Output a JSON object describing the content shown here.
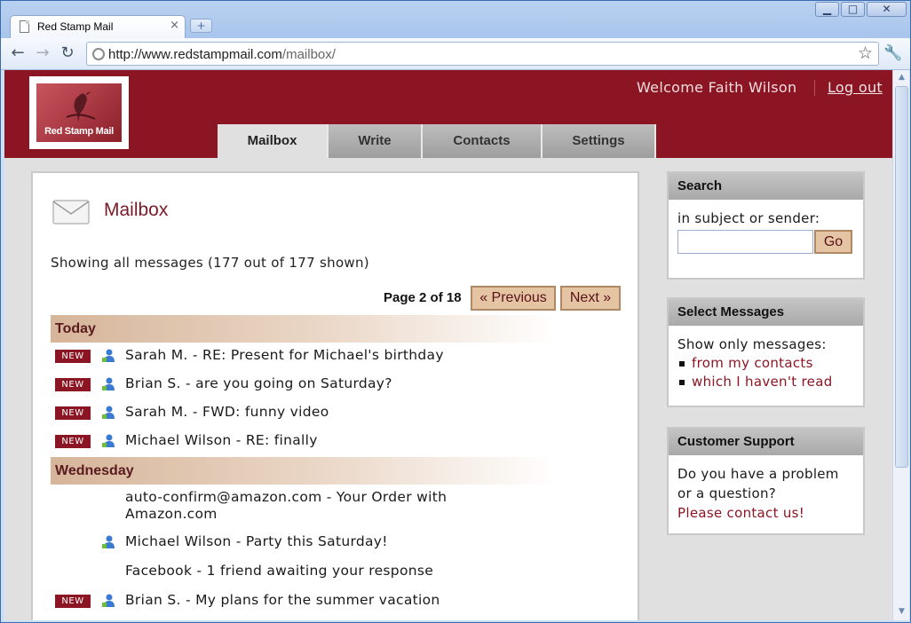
{
  "browser": {
    "tab_title": "Red Stamp Mail",
    "tab_close": "×",
    "new_tab": "+",
    "url_main": "http://www.redstampmail.com",
    "url_path": "/mailbox/",
    "window_controls": [
      "minimize",
      "maximize",
      "close"
    ]
  },
  "header": {
    "logo_text": "Red Stamp Mail",
    "welcome": "Welcome Faith Wilson",
    "logout": "Log out",
    "accent": "#8b1522"
  },
  "nav": {
    "tabs": [
      {
        "label": "Mailbox",
        "active": true
      },
      {
        "label": "Write",
        "active": false
      },
      {
        "label": "Contacts",
        "active": false
      },
      {
        "label": "Settings",
        "active": false
      }
    ]
  },
  "mailbox": {
    "title": "Mailbox",
    "showing": "Showing all messages (177 out of 177 shown)",
    "page_info": "Page 2 of 18",
    "prev_label": "« Previous",
    "next_label": "Next »",
    "new_badge": "NEW",
    "groups": [
      {
        "day": "Today",
        "messages": [
          {
            "new": true,
            "contact": true,
            "text": "Sarah M. - RE: Present for Michael's birthday"
          },
          {
            "new": true,
            "contact": true,
            "text": "Brian S. - are you going on Saturday?"
          },
          {
            "new": true,
            "contact": true,
            "text": "Sarah M. - FWD: funny video"
          },
          {
            "new": true,
            "contact": true,
            "text": "Michael Wilson - RE: finally"
          }
        ]
      },
      {
        "day": "Wednesday",
        "messages": [
          {
            "new": false,
            "contact": false,
            "text": "auto-confirm@amazon.com - Your Order with Amazon.com"
          },
          {
            "new": false,
            "contact": true,
            "text": "Michael Wilson - Party this Saturday!"
          },
          {
            "new": false,
            "contact": false,
            "text": "Facebook - 1 friend awaiting your response"
          },
          {
            "new": true,
            "contact": true,
            "text": "Brian S. - My plans for the summer vacation"
          }
        ]
      }
    ]
  },
  "sidebar": {
    "search": {
      "title": "Search",
      "label": "in subject or sender:",
      "go": "Go"
    },
    "select": {
      "title": "Select Messages",
      "label": "Show only messages:",
      "links": [
        "from my contacts",
        "which I haven't read"
      ]
    },
    "support": {
      "title": "Customer Support",
      "text": "Do you have a problem or a question?",
      "link": "Please contact us!"
    }
  }
}
